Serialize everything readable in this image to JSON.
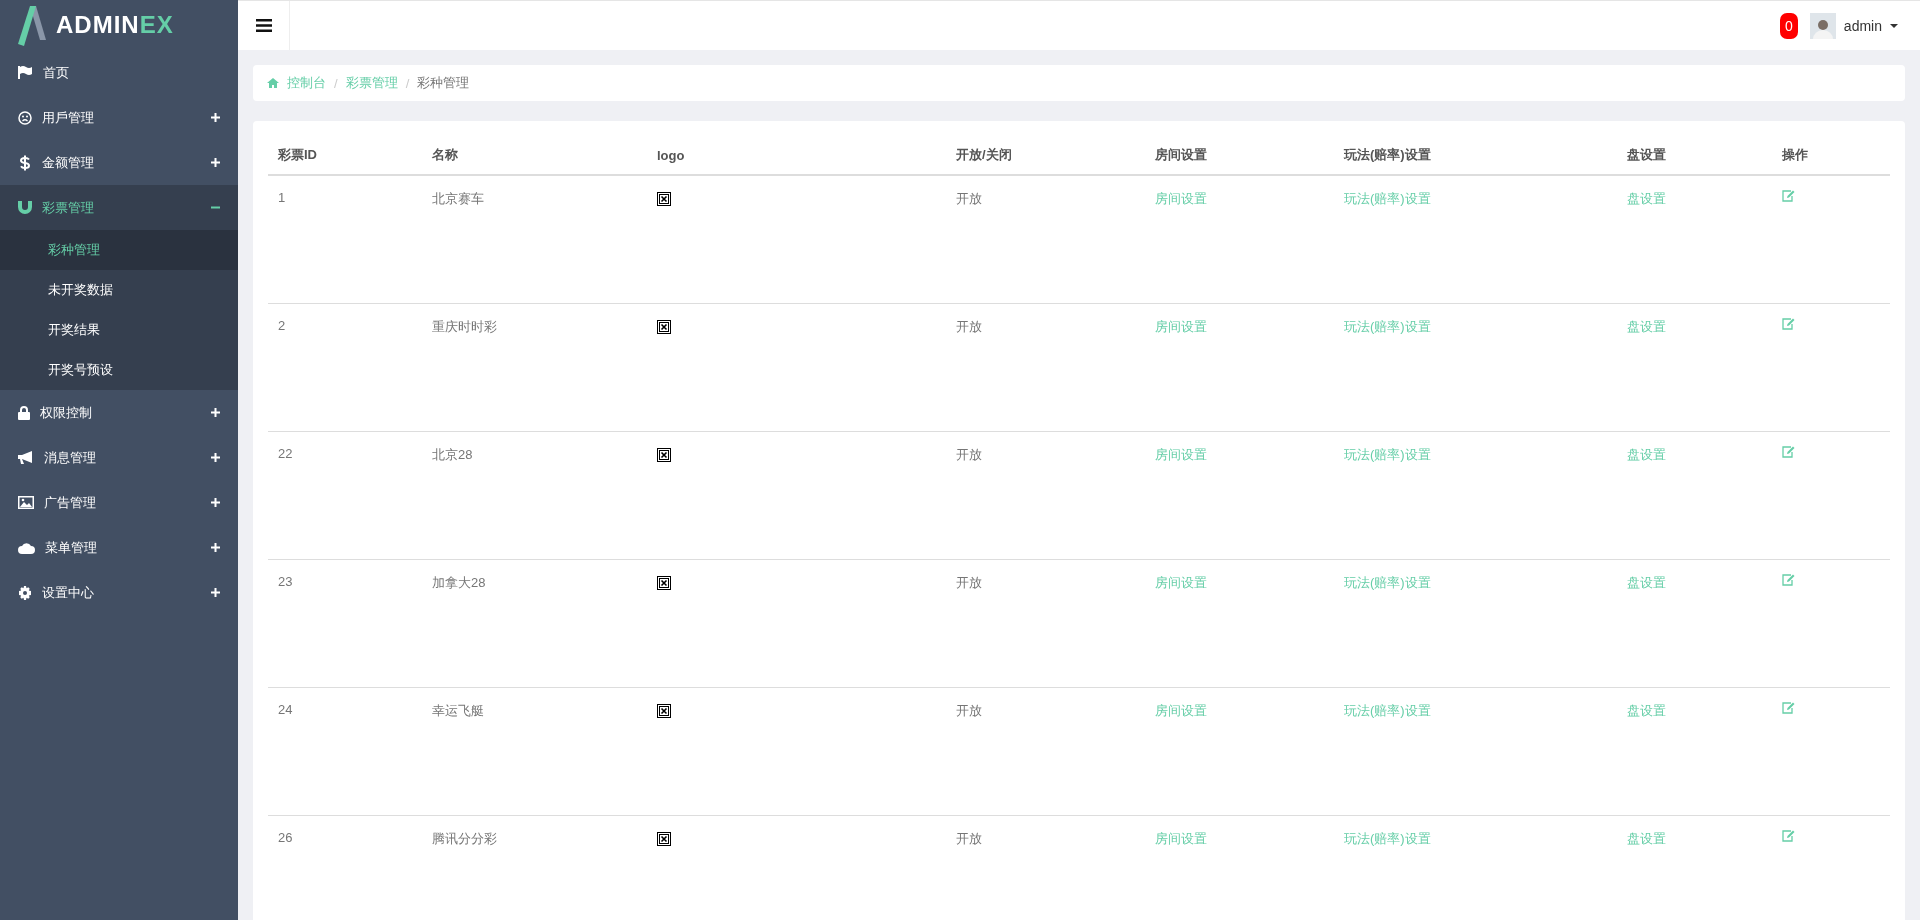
{
  "brand": {
    "name_main": "ADMIN",
    "name_accent": "EX"
  },
  "sidebar": {
    "items": [
      {
        "label": "首页",
        "selected": false
      },
      {
        "label": "用戶管理",
        "expanded": false,
        "selected": false
      },
      {
        "label": "金额管理",
        "expanded": false,
        "selected": false
      },
      {
        "label": "彩票管理",
        "expanded": true,
        "selected": true,
        "children": [
          {
            "label": "彩种管理",
            "selected": true
          },
          {
            "label": "未开奖数据",
            "selected": false
          },
          {
            "label": "开奖结果",
            "selected": false
          },
          {
            "label": "开奖号预设",
            "selected": false
          }
        ]
      },
      {
        "label": "权限控制",
        "expanded": false,
        "selected": false
      },
      {
        "label": "消息管理",
        "expanded": false,
        "selected": false
      },
      {
        "label": "广告管理",
        "expanded": false,
        "selected": false
      },
      {
        "label": "菜单管理",
        "expanded": false,
        "selected": false
      },
      {
        "label": "设置中心",
        "expanded": false,
        "selected": false
      }
    ]
  },
  "header": {
    "notification_count": "0",
    "user": "admin"
  },
  "breadcrumb": [
    {
      "label": "控制台",
      "link": true
    },
    {
      "separator": "/",
      "label": "彩票管理",
      "link": true
    },
    {
      "separator": "/",
      "label": "彩种管理",
      "link": false
    }
  ],
  "table": {
    "columns": [
      "彩票ID",
      "名称",
      "logo",
      "开放/关闭",
      "房间设置",
      "玩法(赔率)设置",
      "盘设置",
      "操作"
    ],
    "rows": [
      {
        "id": "1",
        "name": "北京赛车",
        "status": "开放",
        "room": "房间设置",
        "play": "玩法(赔率)设置",
        "pan": "盘设置"
      },
      {
        "id": "2",
        "name": "重庆时时彩",
        "status": "开放",
        "room": "房间设置",
        "play": "玩法(赔率)设置",
        "pan": "盘设置"
      },
      {
        "id": "22",
        "name": "北京28",
        "status": "开放",
        "room": "房间设置",
        "play": "玩法(赔率)设置",
        "pan": "盘设置"
      },
      {
        "id": "23",
        "name": "加拿大28",
        "status": "开放",
        "room": "房间设置",
        "play": "玩法(赔率)设置",
        "pan": "盘设置"
      },
      {
        "id": "24",
        "name": "幸运飞艇",
        "status": "开放",
        "room": "房间设置",
        "play": "玩法(赔率)设置",
        "pan": "盘设置"
      },
      {
        "id": "26",
        "name": "腾讯分分彩",
        "status": "开放",
        "room": "房间设置",
        "play": "玩法(赔率)设置",
        "pan": "盘设置"
      }
    ]
  }
}
